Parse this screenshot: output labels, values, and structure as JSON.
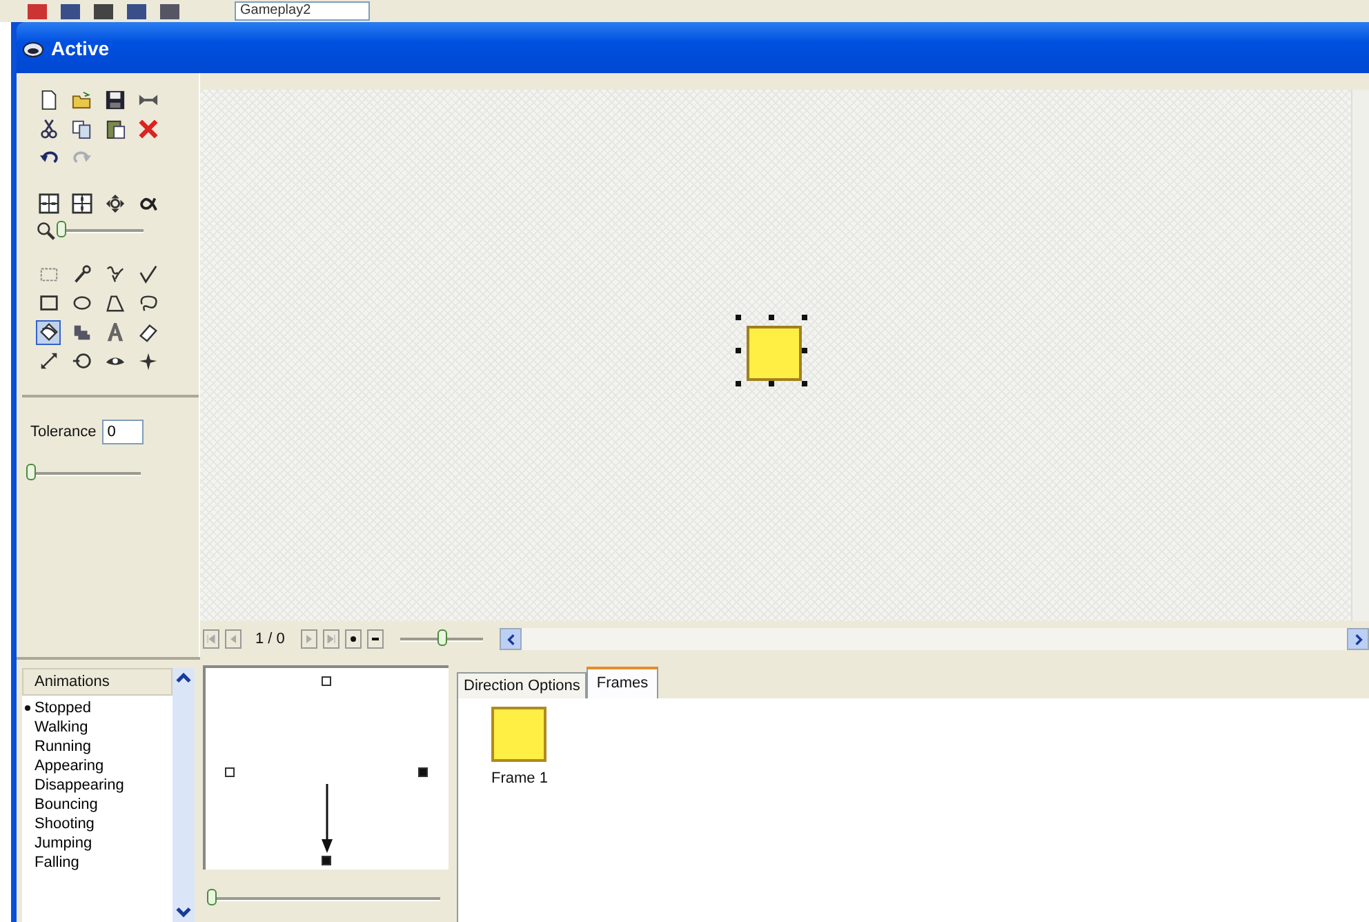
{
  "background_toolbar": {
    "combo_value": "Gameplay2"
  },
  "window": {
    "title": "Active"
  },
  "file_tools": [
    {
      "disabled": false
    },
    {
      "disabled": false
    },
    {
      "disabled": false
    },
    {
      "disabled": false
    },
    {
      "disabled": false
    },
    {
      "disabled": false
    },
    {
      "disabled": false
    },
    {
      "disabled": false
    },
    {
      "disabled": false
    },
    {
      "disabled": true
    }
  ],
  "zoom_slider": {
    "level": 0
  },
  "drawing_tools": [
    {
      "selected": false
    },
    {
      "selected": false
    },
    {
      "selected": false
    },
    {
      "selected": false
    },
    {
      "selected": false
    },
    {
      "selected": false
    },
    {
      "selected": false
    },
    {
      "selected": false
    },
    {
      "selected": true
    },
    {
      "selected": false
    },
    {
      "selected": false
    },
    {
      "selected": false
    },
    {
      "selected": false
    },
    {
      "selected": false
    },
    {
      "selected": false
    },
    {
      "selected": false
    }
  ],
  "tolerance": {
    "label": "Tolerance",
    "value": "0",
    "slider": {
      "level": 0
    }
  },
  "frame_nav": {
    "counter": "1 / 0",
    "speed_slider": {
      "level": 0.5
    }
  },
  "animations": {
    "header": "Animations",
    "items": [
      {
        "name": "Stopped",
        "has_frames": true
      },
      {
        "name": "Walking",
        "has_frames": false
      },
      {
        "name": "Running",
        "has_frames": false
      },
      {
        "name": "Appearing",
        "has_frames": false
      },
      {
        "name": "Disappearing",
        "has_frames": false
      },
      {
        "name": "Bouncing",
        "has_frames": false
      },
      {
        "name": "Shooting",
        "has_frames": false
      },
      {
        "name": "Jumping",
        "has_frames": false
      },
      {
        "name": "Falling",
        "has_frames": false
      }
    ]
  },
  "directions": {
    "markers": [
      {
        "filled": false
      },
      {
        "filled": true
      },
      {
        "filled": true
      },
      {
        "filled": false
      }
    ],
    "slider": {
      "level": 0
    }
  },
  "tabs": [
    {
      "label": "Direction Options",
      "selected": false
    },
    {
      "label": "Frames",
      "selected": true
    }
  ],
  "frames": [
    {
      "label": "Frame 1"
    }
  ]
}
